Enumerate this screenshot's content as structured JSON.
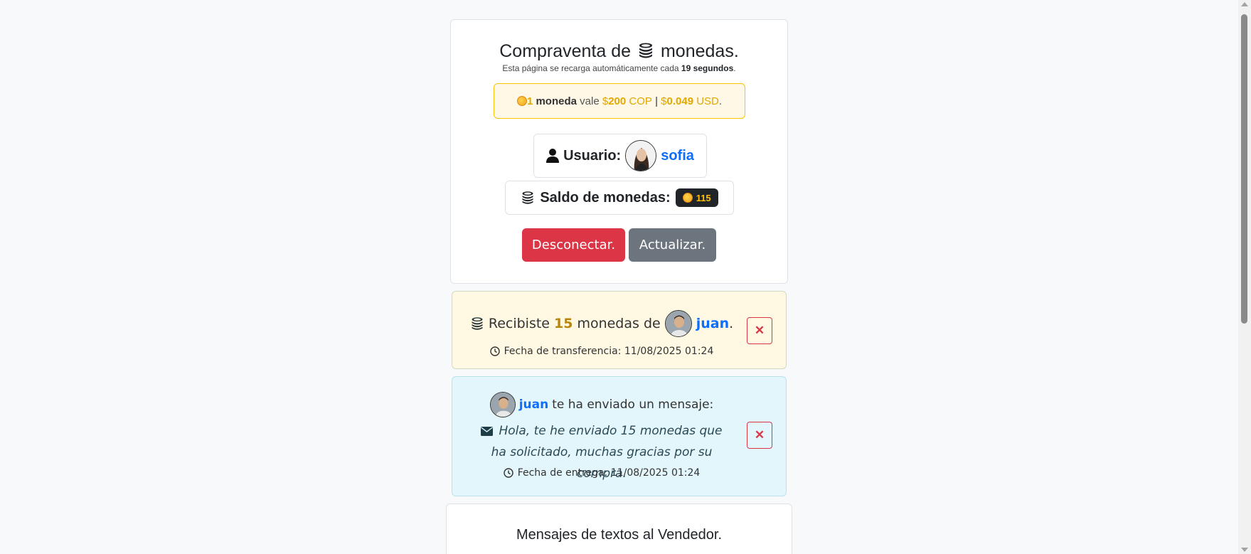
{
  "header": {
    "title_before": "Compraventa de",
    "title_after": "monedas.",
    "subtitle_before": "Esta página se recarga automáticamente cada",
    "reload_seconds": "19 segundos",
    "subtitle_after": "."
  },
  "price": {
    "amount": "1",
    "unit": "moneda",
    "vale": "vale",
    "dollar1": "$",
    "cop_value": "200",
    "cop": "COP",
    "sep": "|",
    "dollar2": "$",
    "usd_value": "0.049",
    "usd": "USD",
    "end": "."
  },
  "user": {
    "label": "Usuario:",
    "name": "sofia"
  },
  "balance": {
    "label": "Saldo de monedas:",
    "value": "115"
  },
  "buttons": {
    "disconnect": "Desconectar.",
    "refresh": "Actualizar."
  },
  "transfer_alert": {
    "prefix": "Recibiste",
    "amount": "15",
    "middle": "monedas de",
    "sender": "juan",
    "end": ".",
    "date_label": "Fecha de transferencia: 11/08/2025 01:24",
    "close": "✕"
  },
  "message_alert": {
    "sender": "juan",
    "header_text": "te ha enviado un mensaje:",
    "body": "Hola, te he enviado 15 monedas que ha solicitado, muchas gracias por su compra.",
    "date_label": "Fecha de entrega: 11/08/2025 01:24",
    "close": "✕"
  },
  "messages_section": {
    "title": "Mensajes de textos al Vendedor."
  },
  "colors": {
    "primary": "#0d6efd",
    "danger": "#dc3545",
    "secondary": "#6c757d",
    "warning": "#ffc107"
  }
}
